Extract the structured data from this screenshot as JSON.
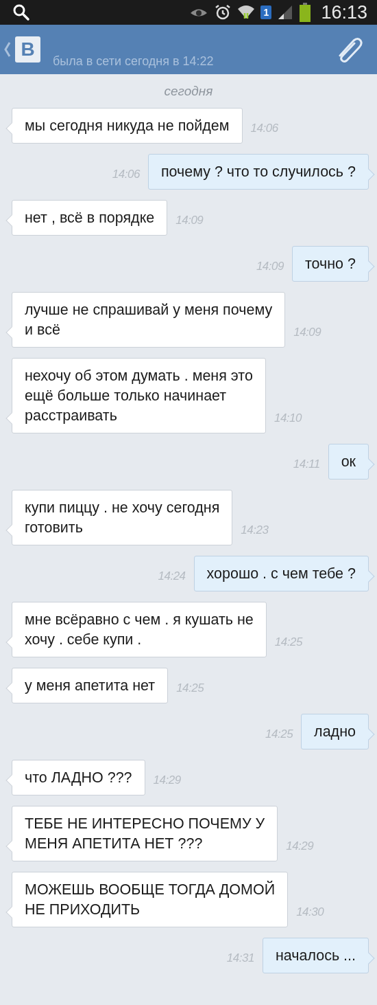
{
  "status_bar": {
    "time": "16:13",
    "sim": "1"
  },
  "header": {
    "logo": "B",
    "status": "была в сети сегодня в 14:22"
  },
  "date_divider": "сегодня",
  "messages": [
    {
      "kind": "in",
      "text": "мы сегодня никуда не пойдем",
      "time": "14:06"
    },
    {
      "kind": "out",
      "text": "почему ? что то случилось ?",
      "time": "14:06"
    },
    {
      "kind": "in",
      "text": "нет , всё в порядке",
      "time": "14:09"
    },
    {
      "kind": "out",
      "text": "точно ?",
      "time": "14:09"
    },
    {
      "kind": "in",
      "text": "лучше не спрашивай у меня почему\nи всё",
      "time": "14:09"
    },
    {
      "kind": "in",
      "text": "нехочу об этом думать . меня это\nещё больше только начинает\nрасстраивать",
      "time": "14:10"
    },
    {
      "kind": "out",
      "text": "ок",
      "time": "14:11"
    },
    {
      "kind": "in",
      "text": "купи пиццу . не хочу сегодня\nготовить",
      "time": "14:23"
    },
    {
      "kind": "out",
      "text": "хорошо . с чем тебе ?",
      "time": "14:24"
    },
    {
      "kind": "in",
      "text": "мне всёравно с чем . я кушать не\nхочу . себе купи .",
      "time": "14:25"
    },
    {
      "kind": "in",
      "text": "у меня апетита нет",
      "time": "14:25"
    },
    {
      "kind": "out",
      "text": "ладно",
      "time": "14:25"
    },
    {
      "kind": "in",
      "text": "что ЛАДНО ???",
      "time": "14:29"
    },
    {
      "kind": "in",
      "text": "ТЕБЕ НЕ ИНТЕРЕСНО ПОЧЕМУ У\nМЕНЯ АПЕТИТА НЕТ ???",
      "time": "14:29"
    },
    {
      "kind": "in",
      "text": "МОЖЕШЬ ВООБЩЕ ТОГДА ДОМОЙ\nНЕ ПРИХОДИТЬ",
      "time": "14:30"
    },
    {
      "kind": "out",
      "text": "началось ...",
      "time": "14:31"
    }
  ]
}
